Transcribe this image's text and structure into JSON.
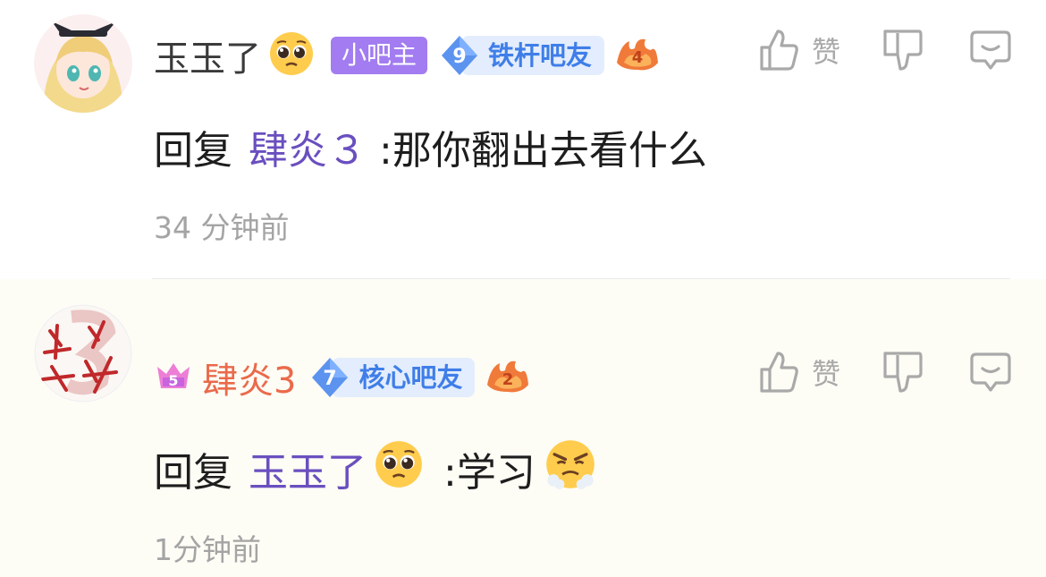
{
  "comments": [
    {
      "username": "玉玉了",
      "username_emoji": "pleading-face",
      "role_tag": "小吧主",
      "level_number": "9",
      "level_title": "铁杆吧友",
      "fire_badge_number": "4",
      "reply_prefix": "回复",
      "reply_to": "肆炎３",
      "reply_text": ":那你翻出去看什么",
      "time": "34 分钟前",
      "like_label": "赞"
    },
    {
      "username": "肆炎3",
      "vip_icon_number": "5",
      "level_number": "7",
      "level_title": "核心吧友",
      "fire_badge_number": "2",
      "reply_prefix": "回复",
      "reply_to": "玉玉了",
      "reply_to_emoji": "pleading-face",
      "reply_text": ":学习",
      "reply_emoji": "triumph-face",
      "time": "1分钟前",
      "like_label": "赞"
    }
  ],
  "colors": {
    "mod_tag_bg": "#a27cf0",
    "level_pill_bg": "#e3edfd",
    "level_text": "#3f7ee8",
    "mention_color": "#6a4fbf",
    "username_highlight": "#ea6a4a",
    "time_color": "#a4a4a4",
    "action_icon_color": "#a9a9a9",
    "second_comment_bg": "#fdfcf5"
  },
  "icons": [
    "thumbs-up-icon",
    "thumbs-down-icon",
    "reply-bubble-icon",
    "level-gem-icon",
    "fire-badge-icon",
    "vip-crown-icon"
  ]
}
